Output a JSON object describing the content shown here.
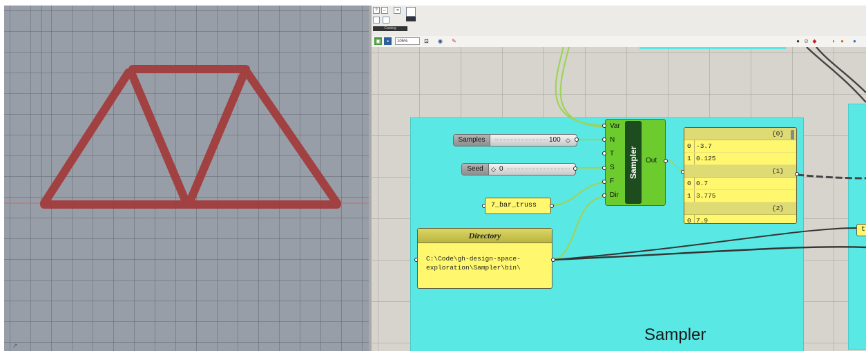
{
  "grasshopper": {
    "ribbon": {
      "group_label": "Catalog"
    },
    "toolbar": {
      "zoom": "105%"
    },
    "sampler_group": {
      "title": "Sampler",
      "sliders": [
        {
          "name": "Samples",
          "value": "100"
        },
        {
          "name": "Seed",
          "value": "0"
        }
      ],
      "truss_panel": "7_bar_truss",
      "directory_panel": {
        "title": "Directory",
        "text": "C:\\Code\\gh-design-space-\nexploration\\Sampler\\bin\\"
      },
      "component": {
        "name": "Sampler",
        "inputs": [
          "Var",
          "N",
          "T",
          "S",
          "F",
          "Dir"
        ],
        "output": "Out"
      },
      "output_panel": {
        "branches": [
          {
            "path": "{0}",
            "items": [
              {
                "index": "0",
                "value": "-3.7"
              },
              {
                "index": "1",
                "value": "0.125"
              }
            ]
          },
          {
            "path": "{1}",
            "items": [
              {
                "index": "0",
                "value": "0.7"
              },
              {
                "index": "1",
                "value": "3.775"
              }
            ]
          },
          {
            "path": "{2}",
            "items": [
              {
                "index": "0",
                "value": "7.9"
              }
            ]
          }
        ]
      }
    },
    "side_panel_text": "t"
  },
  "colors": {
    "group_fill": "#5ae8e5",
    "component_green": "#6ccc2e",
    "panel_yellow": "#fff86e",
    "truss_red": "#a83a3a",
    "wire_green": "#9ed35a"
  }
}
